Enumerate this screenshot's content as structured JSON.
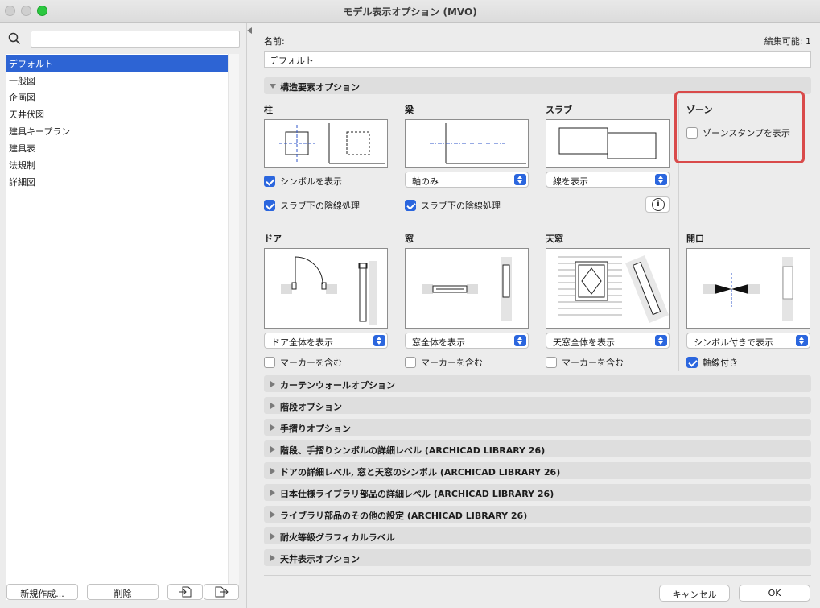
{
  "window": {
    "title": "モデル表示オプション (MVO)"
  },
  "sidebar": {
    "search_placeholder": "",
    "items": [
      {
        "label": "デフォルト",
        "selected": true
      },
      {
        "label": "一般図"
      },
      {
        "label": "企画図"
      },
      {
        "label": "天井伏図"
      },
      {
        "label": "建具キープラン"
      },
      {
        "label": "建具表"
      },
      {
        "label": "法規制"
      },
      {
        "label": "詳細図"
      }
    ],
    "new_button": "新規作成...",
    "delete_button": "削除"
  },
  "main": {
    "name_label": "名前:",
    "editable_label": "編集可能: 1",
    "name_value": "デフォルト",
    "structure_section": "構造要素オプション",
    "column": {
      "title": "柱",
      "show_symbol": "シンボルを表示",
      "show_symbol_checked": true,
      "slab_hidden": "スラブ下の陰線処理",
      "slab_hidden_checked": true
    },
    "beam": {
      "title": "梁",
      "select_value": "軸のみ",
      "slab_hidden": "スラブ下の陰線処理",
      "slab_hidden_checked": true
    },
    "slab": {
      "title": "スラブ",
      "select_value": "線を表示",
      "info_icon": "info-icon"
    },
    "zone": {
      "title": "ゾーン",
      "show_stamp": "ゾーンスタンプを表示",
      "show_stamp_checked": false
    },
    "door": {
      "title": "ドア",
      "select_value": "ドア全体を表示",
      "include_marker": "マーカーを含む",
      "include_marker_checked": false
    },
    "window": {
      "title": "窓",
      "select_value": "窓全体を表示",
      "include_marker": "マーカーを含む",
      "include_marker_checked": false
    },
    "skylight": {
      "title": "天窓",
      "select_value": "天窓全体を表示",
      "include_marker": "マーカーを含む",
      "include_marker_checked": false
    },
    "opening": {
      "title": "開口",
      "select_value": "シンボル付きで表示",
      "with_axis": "軸線付き",
      "with_axis_checked": true
    },
    "collapsed_sections": [
      "カーテンウォールオプション",
      "階段オプション",
      "手摺りオプション",
      "階段、手摺りシンボルの詳細レベル (ARCHICAD LIBRARY 26)",
      "ドアの詳細レベル, 窓と天窓のシンボル (ARCHICAD LIBRARY 26)",
      "日本仕様ライブラリ部品の詳細レベル (ARCHICAD LIBRARY 26)",
      "ライブラリ部品のその他の設定 (ARCHICAD LIBRARY 26)",
      "耐火等級グラフィカルラベル",
      "天井表示オプション"
    ]
  },
  "footer": {
    "cancel": "キャンセル",
    "ok": "OK"
  },
  "colors": {
    "accent": "#2b66de",
    "selection": "#2d64d4",
    "highlight": "#d94a4a"
  }
}
